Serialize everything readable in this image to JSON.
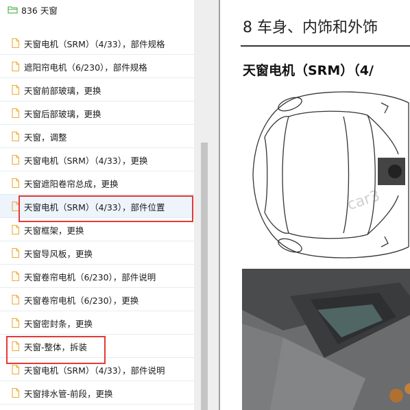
{
  "tree": {
    "folder_label": "836 天窗",
    "items": [
      {
        "label": "天窗电机（SRM）（4/33），部件规格"
      },
      {
        "label": "遮阳帘电机（6/230），部件规格"
      },
      {
        "label": "天窗前部玻璃，更换"
      },
      {
        "label": "天窗后部玻璃，更换"
      },
      {
        "label": "天窗，调整"
      },
      {
        "label": "天窗电机（SRM）（4/33），更换"
      },
      {
        "label": "天窗遮阳卷帘总成，更换"
      },
      {
        "label": "天窗电机（SRM）（4/33），部件位置"
      },
      {
        "label": "天窗框架，更换"
      },
      {
        "label": "天窗导风板，更换"
      },
      {
        "label": "天窗卷帘电机（6/230），部件说明"
      },
      {
        "label": "天窗卷帘电机（6/230），更换"
      },
      {
        "label": "天窗密封条，更换"
      },
      {
        "label": "天窗-整体，拆装"
      },
      {
        "label": "天窗电机（SRM）（4/33），部件说明"
      },
      {
        "label": "天窗排水管-前段，更换"
      }
    ]
  },
  "document": {
    "chapter": "8 车身、内饰和外饰",
    "section": "天窗电机（SRM）（4/",
    "watermark": "car3"
  },
  "colors": {
    "highlight": "#e53935",
    "file_icon": "#f0a830",
    "folder_icon": "#5cb85c"
  }
}
